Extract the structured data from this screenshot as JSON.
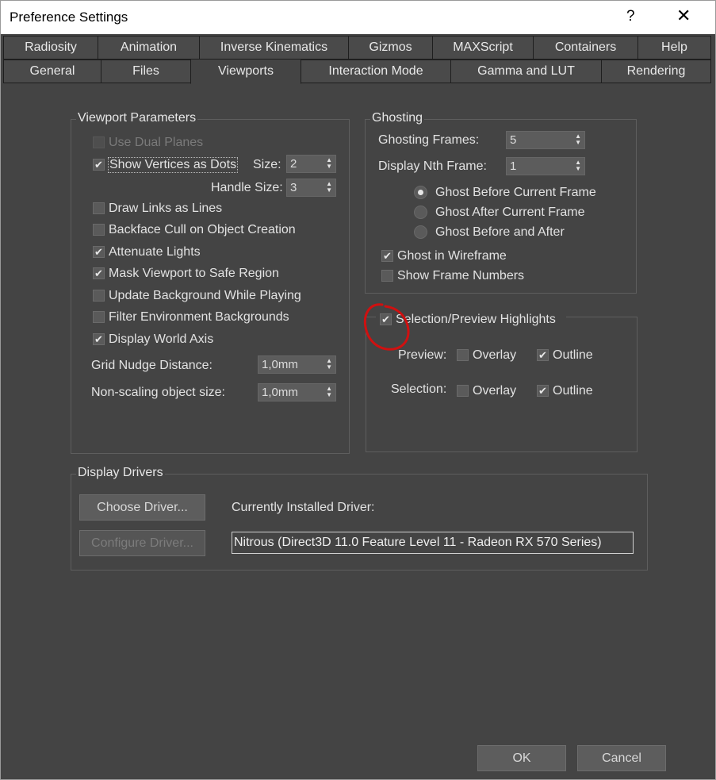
{
  "window": {
    "title": "Preference Settings",
    "help_glyph": "?",
    "close_glyph": "✕"
  },
  "tabs": {
    "row1": [
      "Radiosity",
      "Animation",
      "Inverse Kinematics",
      "Gizmos",
      "MAXScript",
      "Containers",
      "Help"
    ],
    "row2": [
      "General",
      "Files",
      "Viewports",
      "Interaction Mode",
      "Gamma and LUT",
      "Rendering"
    ],
    "active": "Viewports"
  },
  "viewport_params": {
    "title": "Viewport Parameters",
    "use_dual_planes": "Use Dual Planes",
    "show_vertices": "Show Vertices as Dots",
    "size_label": "Size:",
    "size_value": "2",
    "handle_size_label": "Handle Size:",
    "handle_size_value": "3",
    "draw_links": "Draw Links as Lines",
    "backface_cull": "Backface Cull on Object Creation",
    "attenuate_lights": "Attenuate Lights",
    "mask_viewport": "Mask Viewport to Safe Region",
    "update_background": "Update Background While Playing",
    "filter_env": "Filter Environment Backgrounds",
    "display_world_axis": "Display World Axis",
    "grid_nudge_label": "Grid Nudge Distance:",
    "grid_nudge_value": "1,0mm",
    "non_scaling_label": "Non-scaling object size:",
    "non_scaling_value": "1,0mm",
    "checked": {
      "use_dual_planes": false,
      "show_vertices": true,
      "draw_links": false,
      "backface_cull": false,
      "attenuate_lights": true,
      "mask_viewport": true,
      "update_background": false,
      "filter_env": false,
      "display_world_axis": true
    }
  },
  "ghosting": {
    "title": "Ghosting",
    "frames_label": "Ghosting Frames:",
    "frames_value": "5",
    "nth_label": "Display Nth Frame:",
    "nth_value": "1",
    "radio_before": "Ghost Before Current Frame",
    "radio_after": "Ghost After Current Frame",
    "radio_both": "Ghost Before and After",
    "selected_radio": "Ghost Before Current Frame",
    "ghost_wireframe": "Ghost in Wireframe",
    "show_frame_numbers": "Show Frame Numbers",
    "ghost_wireframe_checked": true,
    "show_frame_numbers_checked": false
  },
  "highlights": {
    "title": "Selection/Preview Highlights",
    "checked": true,
    "preview_label": "Preview:",
    "selection_label": "Selection:",
    "overlay": "Overlay",
    "outline": "Outline",
    "preview_overlay_checked": false,
    "preview_outline_checked": true,
    "selection_overlay_checked": false,
    "selection_outline_checked": true,
    "annotation_color": "#d01010"
  },
  "display_drivers": {
    "title": "Display Drivers",
    "choose_driver": "Choose Driver...",
    "configure_driver": "Configure Driver...",
    "installed_label": "Currently Installed Driver:",
    "installed_value": "Nitrous (Direct3D 11.0 Feature Level 11 - Radeon RX 570 Series)"
  },
  "footer": {
    "ok": "OK",
    "cancel": "Cancel"
  },
  "check_glyph": "✔",
  "spinner_glyph_up": "▲",
  "spinner_glyph_down": "▼"
}
